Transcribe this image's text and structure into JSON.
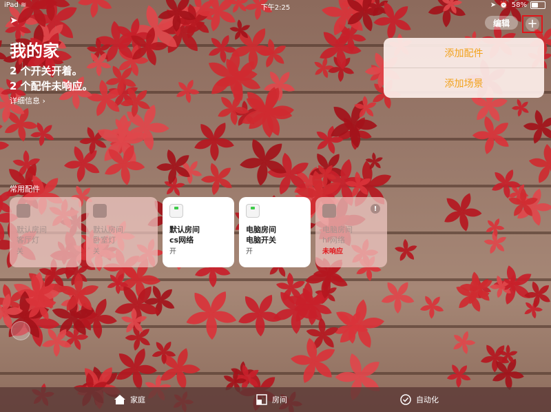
{
  "status_bar": {
    "device": "iPad",
    "time": "下午2:25",
    "battery": "58%",
    "battery_fraction": 0.58
  },
  "header": {
    "edit_label": "编辑",
    "add_label": "+"
  },
  "home": {
    "title": "我的家",
    "status_lines": [
      "2 个开关开着。",
      "2 个配件未响应。"
    ],
    "details_label": "详细信息 ›"
  },
  "popup_menu": {
    "items": [
      "添加配件",
      "添加场景"
    ]
  },
  "favorites": {
    "label": "常用配件",
    "tiles": [
      {
        "room": "默认房间",
        "name": "客厅灯",
        "state": "关",
        "status": "off"
      },
      {
        "room": "默认房间",
        "name": "卧室灯",
        "state": "关",
        "status": "off"
      },
      {
        "room": "默认房间",
        "name": "cs网络",
        "state": "开",
        "status": "on"
      },
      {
        "room": "电脑房间",
        "name": "电脑开关",
        "state": "开",
        "status": "on"
      },
      {
        "room": "电脑房间",
        "name": "hf网络",
        "state": "未响应",
        "status": "unresponsive"
      }
    ]
  },
  "tabbar": {
    "tabs": [
      {
        "label": "家庭",
        "icon": "house-icon"
      },
      {
        "label": "房间",
        "icon": "rooms-icon"
      },
      {
        "label": "自动化",
        "icon": "automation-icon"
      }
    ]
  },
  "colors": {
    "accent": "#f2a21b",
    "highlight_box": "#e0151b",
    "error": "#e0151b"
  }
}
